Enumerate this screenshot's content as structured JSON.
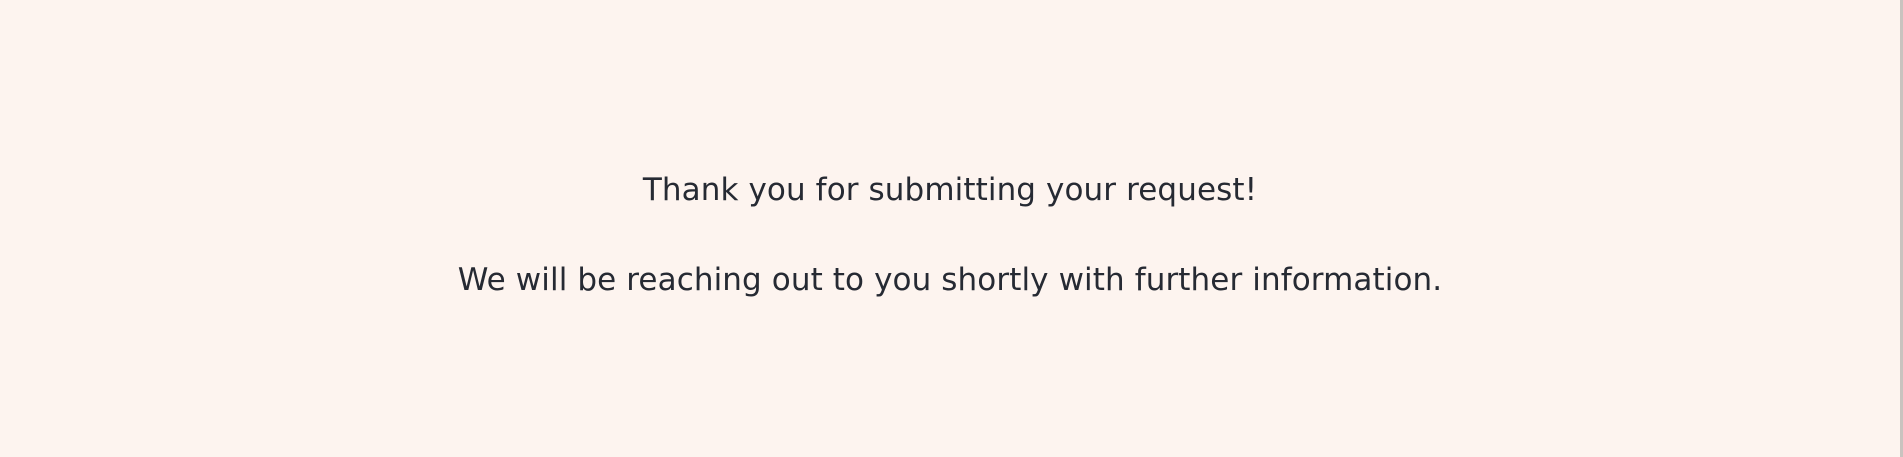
{
  "confirmation": {
    "heading": "Thank you for submitting your request!",
    "message": "We will be reaching out to you shortly with further information."
  },
  "colors": {
    "background": "#fdf4ef",
    "text": "#262a33"
  }
}
